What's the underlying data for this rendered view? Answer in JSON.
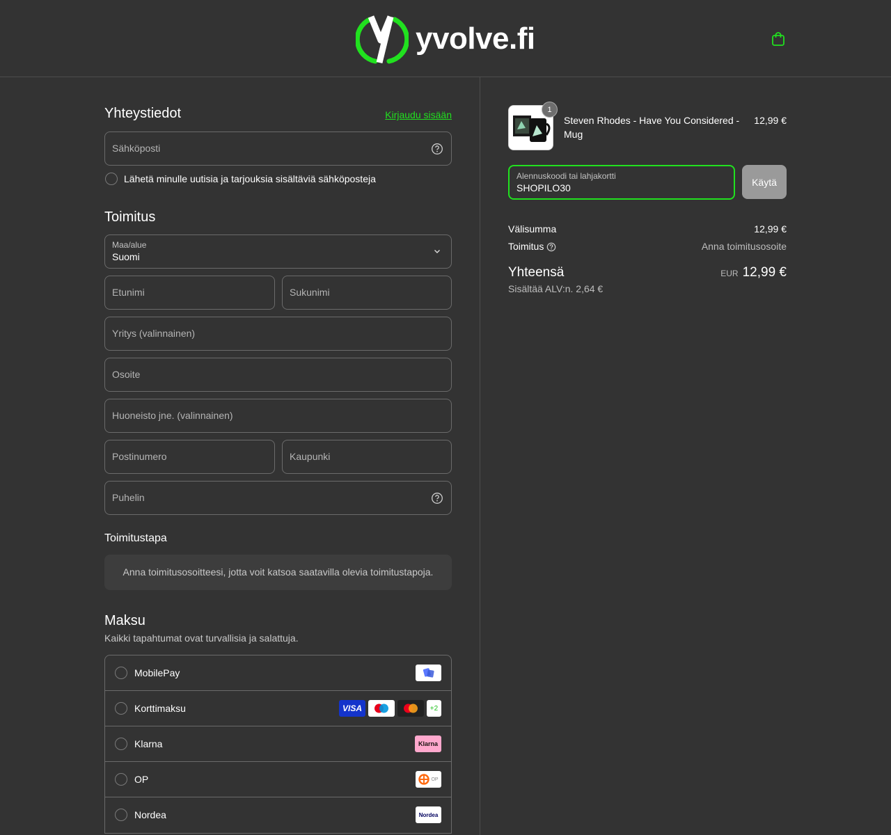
{
  "header": {
    "brand": "yvolve.fi"
  },
  "colors": {
    "accent": "#21e11f",
    "background": "#333333"
  },
  "contact": {
    "title": "Yhteystiedot",
    "login_link": "Kirjaudu sisään",
    "email_placeholder": "Sähköposti",
    "newsletter_label": "Lähetä minulle uutisia ja tarjouksia sisältäviä sähköposteja"
  },
  "delivery": {
    "title": "Toimitus",
    "country_label": "Maa/alue",
    "country_value": "Suomi",
    "first_name_placeholder": "Etunimi",
    "last_name_placeholder": "Sukunimi",
    "company_placeholder": "Yritys (valinnainen)",
    "address_placeholder": "Osoite",
    "apartment_placeholder": "Huoneisto jne. (valinnainen)",
    "postal_placeholder": "Postinumero",
    "city_placeholder": "Kaupunki",
    "phone_placeholder": "Puhelin"
  },
  "shipping_method": {
    "title": "Toimitustapa",
    "notice": "Anna toimitusosoitteesi, jotta voit katsoa saatavilla olevia toimitustapoja."
  },
  "payment": {
    "title": "Maksu",
    "subtitle": "Kaikki tapahtumat ovat turvallisia ja salattuja.",
    "methods": [
      {
        "label": "MobilePay"
      },
      {
        "label": "Korttimaksu",
        "badges": [
          "VISA",
          "+2"
        ]
      },
      {
        "label": "Klarna",
        "badge": "Klarna"
      },
      {
        "label": "OP",
        "badge": "OP"
      },
      {
        "label": "Nordea",
        "badge": "Nordea"
      }
    ]
  },
  "summary": {
    "product_name": "Steven Rhodes - Have You Considered - Mug",
    "product_price": "12,99 €",
    "quantity": "1",
    "discount_label": "Alennuskoodi tai lahjakortti",
    "discount_value": "SHOPILO30",
    "apply_label": "Käytä",
    "subtotal_label": "Välisumma",
    "subtotal_value": "12,99 €",
    "shipping_label": "Toimitus",
    "shipping_value": "Anna toimitusosoite",
    "total_label": "Yhteensä",
    "total_currency": "EUR",
    "total_value": "12,99 €",
    "vat_note": "Sisältää ALV:n. 2,64 €"
  }
}
